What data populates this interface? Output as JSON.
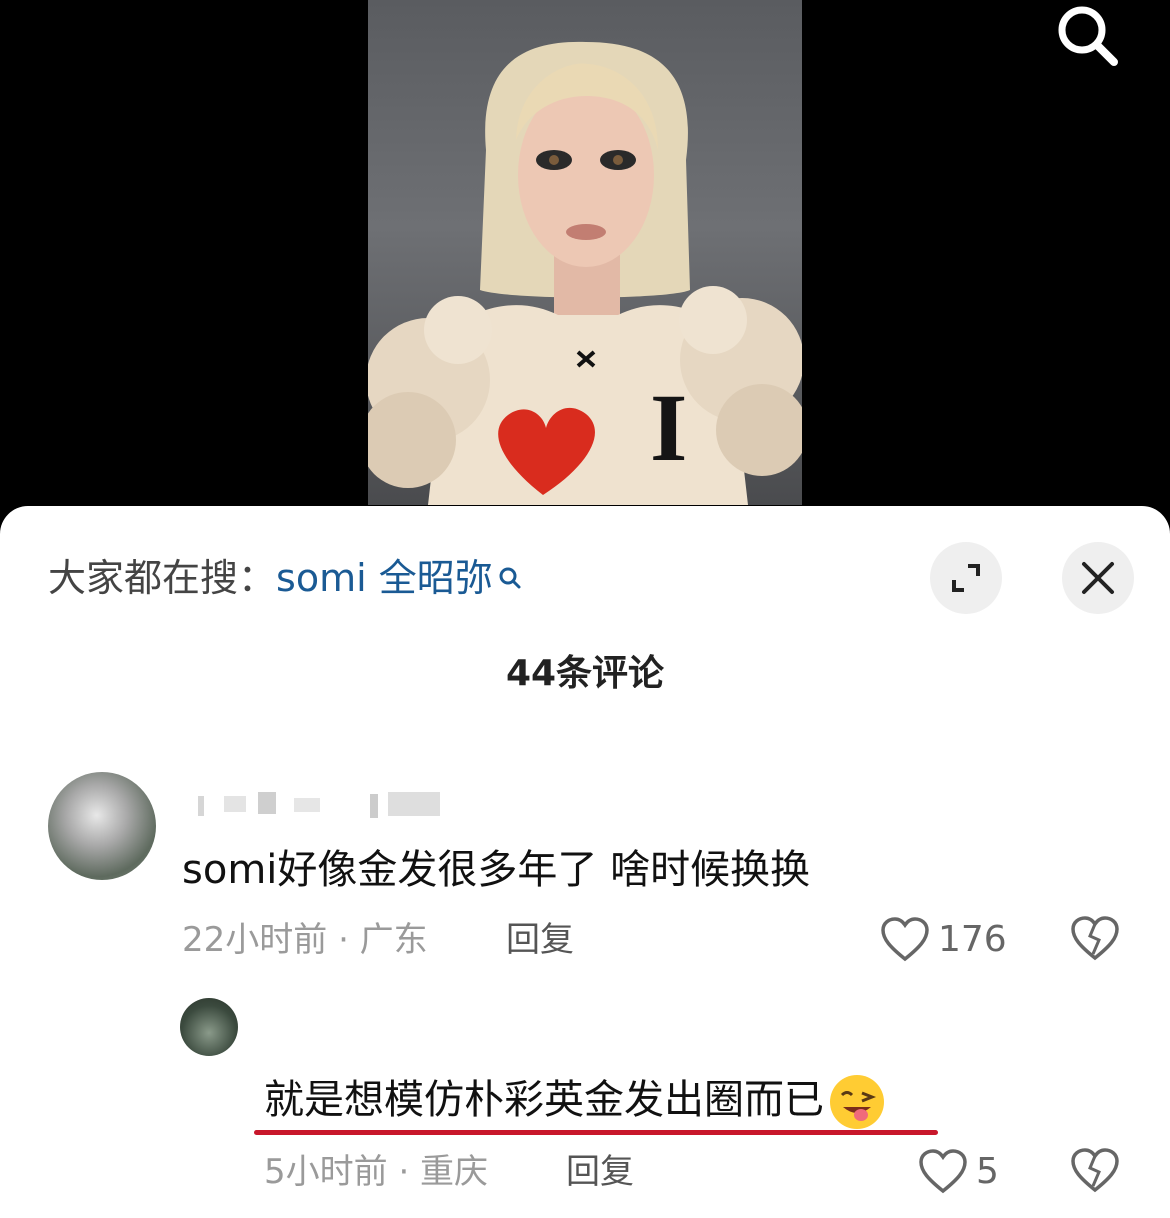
{
  "video": {
    "shirt_text": "I"
  },
  "comments_panel": {
    "suggest_label": "大家都在搜：",
    "suggest_term": "somi 全昭弥",
    "count_title": "44条评论",
    "comments": [
      {
        "text": "somi好像金发很多年了 啥时候换换",
        "time_location": "22小时前 · 广东",
        "reply_label": "回复",
        "likes": "176"
      },
      {
        "text": "就是想模仿朴彩英金发出圈而已",
        "time_location": "5小时前 · 重庆",
        "reply_label": "回复",
        "likes": "5"
      }
    ]
  },
  "colors": {
    "link_blue": "#1a5a94",
    "underline_red": "#c8172b",
    "meta_gray": "#9a9a9a"
  }
}
